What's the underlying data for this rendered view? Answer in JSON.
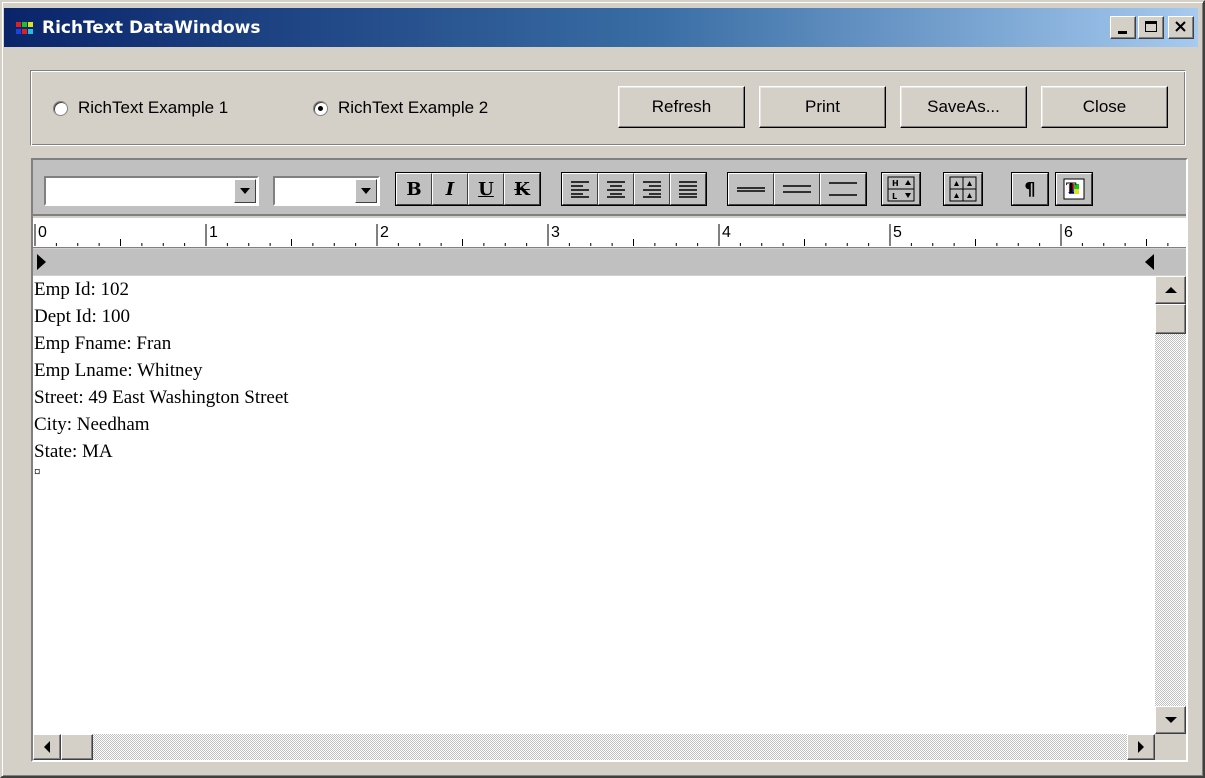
{
  "window": {
    "title": "RichText DataWindows"
  },
  "options": {
    "radio1_label": "RichText Example 1",
    "radio2_label": "RichText Example 2",
    "selected": "RichText Example 2"
  },
  "buttons": {
    "refresh": "Refresh",
    "print": "Print",
    "saveas": "SaveAs...",
    "close": "Close"
  },
  "toolbar": {
    "font_name_value": "",
    "font_size_value": "",
    "bold_label": "B",
    "italic_label": "I",
    "underline_label": "U",
    "strike_label": "K",
    "paragraph_label": "¶"
  },
  "ruler": {
    "marks": [
      "0",
      "1",
      "2",
      "3",
      "4",
      "5",
      "6"
    ]
  },
  "document": {
    "lines": [
      "Emp Id: 102",
      "Dept Id: 100",
      "Emp Fname: Fran",
      "Emp Lname: Whitney",
      "Street: 49 East Washington Street",
      "City: Needham",
      "State: MA",
      "¤"
    ]
  },
  "colors": {
    "titlebar_start": "#0a246a",
    "titlebar_end": "#a6caf0",
    "face": "#d4d0c8"
  }
}
